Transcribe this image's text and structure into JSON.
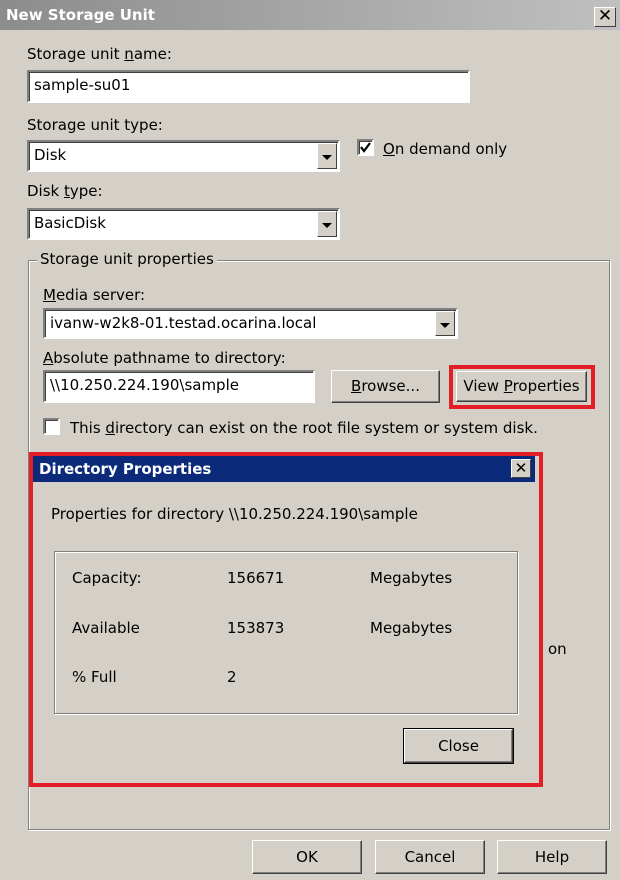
{
  "window": {
    "title": "New Storage Unit",
    "close_glyph": "✕"
  },
  "storage_unit_name": {
    "label_pre": "Storage unit ",
    "label_key": "n",
    "label_post": "ame:",
    "value": "sample-su01"
  },
  "storage_unit_type": {
    "label": "Storage unit type:",
    "value": "Disk"
  },
  "on_demand": {
    "key": "O",
    "label_post": "n demand only",
    "checked": true
  },
  "disk_type": {
    "label_pre": "Disk ",
    "label_key": "t",
    "label_post": "ype:",
    "value": "BasicDisk"
  },
  "properties_group": {
    "label": "Storage unit properties",
    "media_server": {
      "label_key": "M",
      "label_post": "edia server:",
      "value": "ivanw-w2k8-01.testad.ocarina.local"
    },
    "pathname": {
      "label_key": "A",
      "label_post": "bsolute pathname to directory:",
      "value": "\\\\10.250.224.190\\sample"
    },
    "browse_button": {
      "key": "B",
      "post": "rowse..."
    },
    "view_properties_button": {
      "pre": "View ",
      "key": "P",
      "post": "roperties"
    },
    "root_fs": {
      "pre": "This ",
      "key": "d",
      "post": "irectory can exist on the root file system or system disk.",
      "checked": false
    },
    "hidden_text_fragment": "on"
  },
  "buttons": {
    "ok": "OK",
    "cancel": "Cancel",
    "help": "Help"
  },
  "directory_properties": {
    "title": "Directory Properties",
    "close_glyph": "✕",
    "header": "Properties for directory \\\\10.250.224.190\\sample",
    "rows": [
      {
        "label": "Capacity:",
        "value": "156671",
        "unit": "Megabytes"
      },
      {
        "label": "Available",
        "value": "153873",
        "unit": "Megabytes"
      },
      {
        "label": "% Full",
        "value": "2",
        "unit": ""
      }
    ],
    "close_button": "Close"
  },
  "colors": {
    "highlight": "#e41e26",
    "dialog_titlebar": "#0b2a7a",
    "face": "#d4d0c8"
  }
}
